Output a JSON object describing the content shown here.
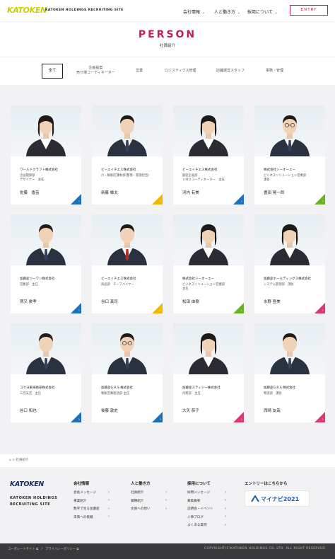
{
  "header": {
    "logo": "KATOKEN",
    "logo_sub": "KATOKEN HOLDINGS RECRUITING SITE",
    "nav": [
      {
        "label": "会社情報"
      },
      {
        "label": "人と働き方"
      },
      {
        "label": "採用について"
      }
    ],
    "entry_label": "ENTRY"
  },
  "page": {
    "title": "PERSON",
    "subtitle": "社員紹介"
  },
  "tabs": [
    {
      "label": "全て",
      "active": true
    },
    {
      "label": "企画提案\n売り場コーディネーター"
    },
    {
      "label": "営業"
    },
    {
      "label": "ロジスティクス管理"
    },
    {
      "label": "店舗運営スタッフ"
    },
    {
      "label": "事務・管理"
    }
  ],
  "cards": [
    {
      "company": "ワールドクラフト株式会社",
      "dept": "企画開発部\nデザイナー　主任",
      "name": "佐藤　香苗",
      "accent": "#1e6fba",
      "figure": "female"
    },
    {
      "company": "ビーエイチエス株式会社",
      "dept": "爪・脚販店課本部(整理・管理担当)",
      "name": "新藤 雄太",
      "accent": "#f2b705",
      "figure": "male"
    },
    {
      "company": "ビーエイチエス株式会社",
      "dept": "販促企画部\nＶＭＤコーディネーター　主任",
      "name": "河内 有美",
      "accent": "#1e6fba",
      "figure": "female"
    },
    {
      "company": "株式会社シーオーエー",
      "dept": "ビジネスソリューション営業部\n課長",
      "name": "豊田 晃一郎",
      "accent": "#6ab023",
      "figure": "male-glasses"
    },
    {
      "company": "加藤産ツーワン株式会社",
      "dept": "営業部　主任",
      "name": "賀又 俊孝",
      "accent": "#1e6fba",
      "figure": "male"
    },
    {
      "company": "ビーエイチエス株式会社",
      "dept": "商品部　チーフバイヤー",
      "name": "谷口 真司",
      "accent": "#f2b705",
      "figure": "male-red"
    },
    {
      "company": "株式会社シーオーエー",
      "dept": "ビジネスソリューション営業部\n主任",
      "name": "松田 由樹",
      "accent": "#6ab023",
      "figure": "female"
    },
    {
      "company": "加藤産ホールディングス株式会社",
      "dept": "システム管理部　課長",
      "name": "水野 亜美",
      "accent": "#d93a6b",
      "figure": "female"
    },
    {
      "company": "コクヨ東海販売株式会社",
      "dept": "三河支店　主任",
      "name": "谷口 和也",
      "accent": "#1e6fba",
      "figure": "male"
    },
    {
      "company": "加藤産G.R.S.株式会社",
      "dept": "製販営業統括部 主任",
      "name": "後藤 敦史",
      "accent": "#1e6fba",
      "figure": "male-glasses"
    },
    {
      "company": "加藤産スティシー株式会社",
      "dept": "内務部　主任",
      "name": "大矢 恭子",
      "accent": "#d93a6b",
      "figure": "female"
    },
    {
      "company": "加藤産G.R.S.株式会社",
      "dept": "物流部　課長",
      "name": "西崎 友哉",
      "accent": "#d93a6b",
      "figure": "male"
    }
  ],
  "breadcrumb": {
    "home_icon": "home-icon",
    "current": "社員紹介"
  },
  "footer": {
    "logo": "KATOKEN",
    "logo_sub": "KATOKEN HOLDINGS\nRECRUITING SITE",
    "col1_head": "会社情報",
    "col1": [
      "会長メッセージ",
      "事業紹介",
      "数字で見る加藤産",
      "未来への挑戦"
    ],
    "col2_head": "人と働き方",
    "col2": [
      "社員紹介",
      "職種紹介",
      "文員への想い"
    ],
    "col3_head": "採用について",
    "col3": [
      "採用メッセージ",
      "募集概要",
      "説明会・イベント",
      "人事ブログ",
      "よくある質問"
    ],
    "col4_head": "エントリーはこちらから",
    "mynavi_label": "マイナビ2021",
    "bottom_left": "コーポレートサイト ⧉　/　プライバシーポリシー ⧉",
    "copyright": "COPYRIGHT(C)KATOKEN HOLDINGS CO.,LTD. ALL RIGHT RESERVED."
  }
}
